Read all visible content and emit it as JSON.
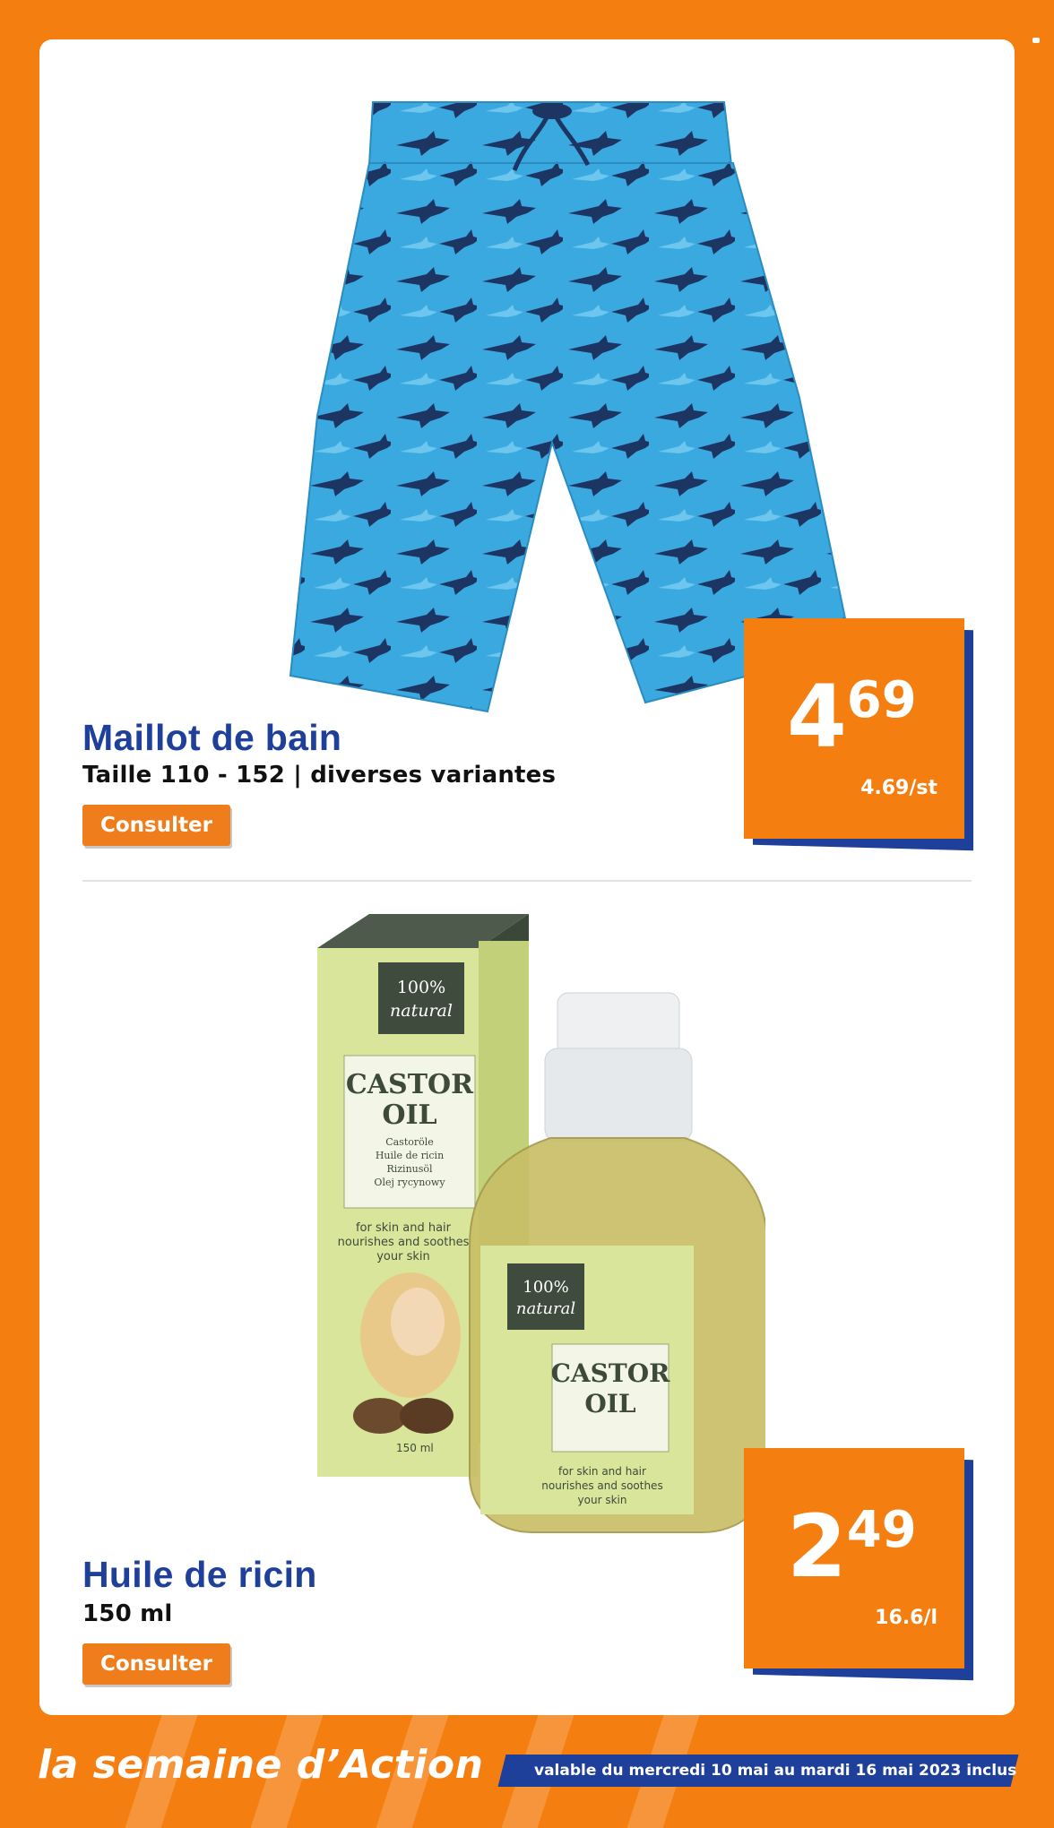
{
  "products": [
    {
      "title": "Maillot de bain",
      "subtitle": "Taille 110 - 152 | diverses variantes",
      "button_label": "Consulter",
      "price_int": "4",
      "price_dec": "69",
      "unit_price": "4.69/st",
      "image_icon": "swim-shorts-image"
    },
    {
      "title": "Huile de ricin",
      "subtitle": "150 ml",
      "button_label": "Consulter",
      "price_int": "2",
      "price_dec": "49",
      "unit_price": "16.6/l",
      "image_icon": "castor-oil-image"
    }
  ],
  "packaging": {
    "badge": "100% natural",
    "name_line1": "CASTOR",
    "name_line2": "OIL",
    "languages": [
      "Castoröle",
      "Huile de ricin",
      "Rizinusöl",
      "Olej rycynowy"
    ],
    "claim": "for skin and hair nourishes and soothes your skin",
    "volume": "150 ml"
  },
  "footer": {
    "brand": "la semaine d’Action",
    "validity": "valable du mercredi 10 mai au mardi 16 mai 2023 inclus"
  },
  "colors": {
    "brand_orange": "#f57e10",
    "brand_blue": "#1e3f9a",
    "shorts_blue": "#3aa9e0",
    "shark_navy": "#1d3563",
    "oil_green": "#d8e59a"
  }
}
